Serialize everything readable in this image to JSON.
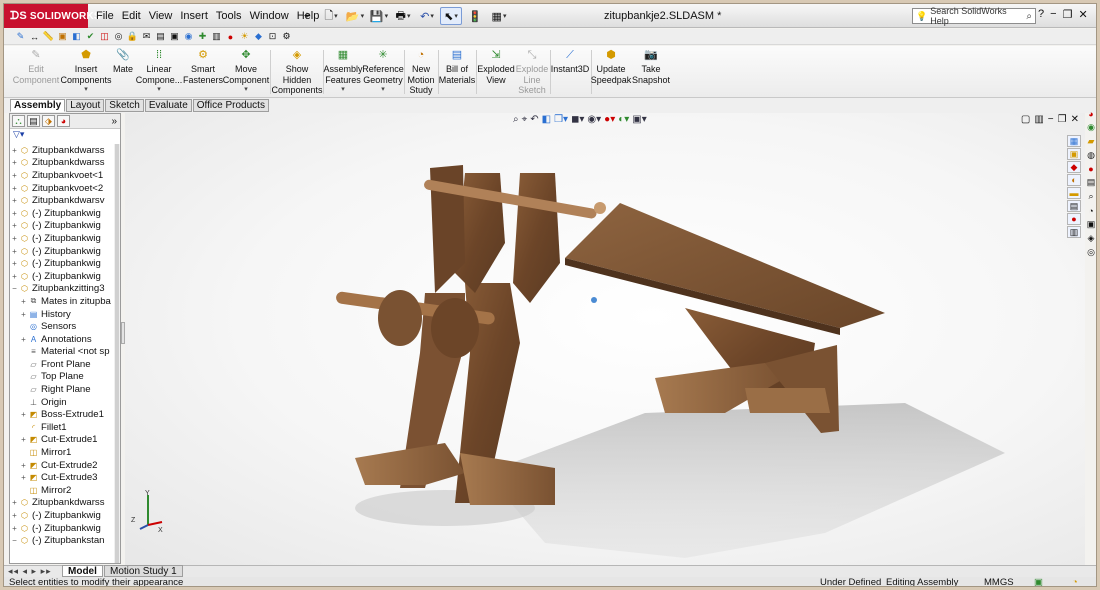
{
  "app": {
    "logo_text": "SOLIDWORKS",
    "document_title": "zitupbankje2.SLDASM *"
  },
  "menu": [
    "File",
    "Edit",
    "View",
    "Insert",
    "Tools",
    "Window",
    "Help"
  ],
  "help_search": {
    "placeholder": "Search SolidWorks Help"
  },
  "commands": [
    {
      "label1": "Edit",
      "label2": "Component",
      "enabled": false,
      "icon": "edit-component-icon"
    },
    {
      "label1": "Insert",
      "label2": "Components",
      "enabled": true,
      "icon": "insert-components-icon",
      "has_menu": true
    },
    {
      "label1": "Mate",
      "label2": "",
      "enabled": true,
      "icon": "mate-icon"
    },
    {
      "label1": "Linear",
      "label2": "Compone...",
      "enabled": true,
      "icon": "linear-pattern-icon",
      "has_menu": true
    },
    {
      "label1": "Smart",
      "label2": "Fasteners",
      "enabled": true,
      "icon": "smart-fasteners-icon"
    },
    {
      "label1": "Move",
      "label2": "Component",
      "enabled": true,
      "icon": "move-component-icon",
      "has_menu": true
    },
    {
      "label1": "Show",
      "label2": "Hidden",
      "label3": "Components",
      "enabled": true,
      "icon": "show-hidden-icon"
    },
    {
      "label1": "Assembly",
      "label2": "Features",
      "enabled": true,
      "icon": "assembly-features-icon",
      "has_menu": true
    },
    {
      "label1": "Reference",
      "label2": "Geometry",
      "enabled": true,
      "icon": "reference-geometry-icon",
      "has_menu": true
    },
    {
      "label1": "New",
      "label2": "Motion",
      "label3": "Study",
      "enabled": true,
      "icon": "motion-study-icon"
    },
    {
      "label1": "Bill of",
      "label2": "Materials",
      "enabled": true,
      "icon": "bom-icon"
    },
    {
      "label1": "Exploded",
      "label2": "View",
      "enabled": true,
      "icon": "exploded-view-icon"
    },
    {
      "label1": "Explode",
      "label2": "Line",
      "label3": "Sketch",
      "enabled": false,
      "icon": "explode-line-icon"
    },
    {
      "label1": "Instant3D",
      "label2": "",
      "enabled": true,
      "icon": "instant3d-icon"
    },
    {
      "label1": "Update",
      "label2": "Speedpak",
      "enabled": true,
      "icon": "speedpak-icon"
    },
    {
      "label1": "Take",
      "label2": "Snapshot",
      "enabled": true,
      "icon": "snapshot-icon"
    }
  ],
  "cm_tabs": [
    {
      "label": "Assembly",
      "active": true
    },
    {
      "label": "Layout",
      "active": false
    },
    {
      "label": "Sketch",
      "active": false
    },
    {
      "label": "Evaluate",
      "active": false
    },
    {
      "label": "Office Products",
      "active": false
    }
  ],
  "tree": {
    "items": [
      {
        "label": "Zitupbankdwarss",
        "expander": "+",
        "icon": "part-icon"
      },
      {
        "label": "Zitupbankdwarss",
        "expander": "+",
        "icon": "part-icon"
      },
      {
        "label": "Zitupbankvoet<1",
        "expander": "+",
        "icon": "part-icon"
      },
      {
        "label": "Zitupbankvoet<2",
        "expander": "+",
        "icon": "part-icon"
      },
      {
        "label": "Zitupbankdwarsv",
        "expander": "+",
        "icon": "part-icon"
      },
      {
        "label": "(-) Zitupbankwig",
        "expander": "+",
        "icon": "part-icon"
      },
      {
        "label": "(-) Zitupbankwig",
        "expander": "+",
        "icon": "part-icon"
      },
      {
        "label": "(-) Zitupbankwig",
        "expander": "+",
        "icon": "part-icon"
      },
      {
        "label": "(-) Zitupbankwig",
        "expander": "+",
        "icon": "part-icon"
      },
      {
        "label": "(-) Zitupbankwig",
        "expander": "+",
        "icon": "part-icon"
      },
      {
        "label": "(-) Zitupbankwig",
        "expander": "+",
        "icon": "part-icon"
      },
      {
        "label": "Zitupbankzitting3",
        "expander": "−",
        "icon": "part-icon"
      },
      {
        "label": "Mates in zitupba",
        "expander": "+",
        "icon": "mates-icon",
        "indent": 1
      },
      {
        "label": "History",
        "expander": "+",
        "icon": "history-icon",
        "indent": 1
      },
      {
        "label": "Sensors",
        "expander": "",
        "icon": "sensors-icon",
        "indent": 1
      },
      {
        "label": "Annotations",
        "expander": "+",
        "icon": "annotations-icon",
        "indent": 1
      },
      {
        "label": "Material <not sp",
        "expander": "",
        "icon": "material-icon",
        "indent": 1
      },
      {
        "label": "Front Plane",
        "expander": "",
        "icon": "plane-icon",
        "indent": 1
      },
      {
        "label": "Top Plane",
        "expander": "",
        "icon": "plane-icon",
        "indent": 1
      },
      {
        "label": "Right Plane",
        "expander": "",
        "icon": "plane-icon",
        "indent": 1
      },
      {
        "label": "Origin",
        "expander": "",
        "icon": "origin-icon",
        "indent": 1
      },
      {
        "label": "Boss-Extrude1",
        "expander": "+",
        "icon": "feature-icon",
        "indent": 1
      },
      {
        "label": "Fillet1",
        "expander": "",
        "icon": "fillet-icon",
        "indent": 1
      },
      {
        "label": "Cut-Extrude1",
        "expander": "+",
        "icon": "feature-icon",
        "indent": 1
      },
      {
        "label": "Mirror1",
        "expander": "",
        "icon": "mirror-icon",
        "indent": 1
      },
      {
        "label": "Cut-Extrude2",
        "expander": "+",
        "icon": "feature-icon",
        "indent": 1
      },
      {
        "label": "Cut-Extrude3",
        "expander": "+",
        "icon": "feature-icon",
        "indent": 1
      },
      {
        "label": "Mirror2",
        "expander": "",
        "icon": "mirror-icon",
        "indent": 1
      },
      {
        "label": "Zitupbankdwarss",
        "expander": "+",
        "icon": "part-icon"
      },
      {
        "label": "(-) Zitupbankwig",
        "expander": "+",
        "icon": "part-icon"
      },
      {
        "label": "(-) Zitupbankwig",
        "expander": "+",
        "icon": "part-icon"
      },
      {
        "label": "(-) Zitupbankstan",
        "expander": "−",
        "icon": "part-icon"
      }
    ]
  },
  "triad": {
    "x": "X",
    "y": "Y",
    "z": "Z"
  },
  "model_tabs": [
    {
      "label": "Model",
      "active": true
    },
    {
      "label": "Motion Study 1",
      "active": false
    }
  ],
  "status": {
    "message": "Select entities to modify their appearance",
    "state": "Under Defined",
    "mode": "Editing Assembly",
    "units": "MMGS"
  },
  "colors": {
    "logo_red": "#c8102e",
    "wood_dark": "#6e4a2d",
    "wood_light": "#a4774d"
  }
}
